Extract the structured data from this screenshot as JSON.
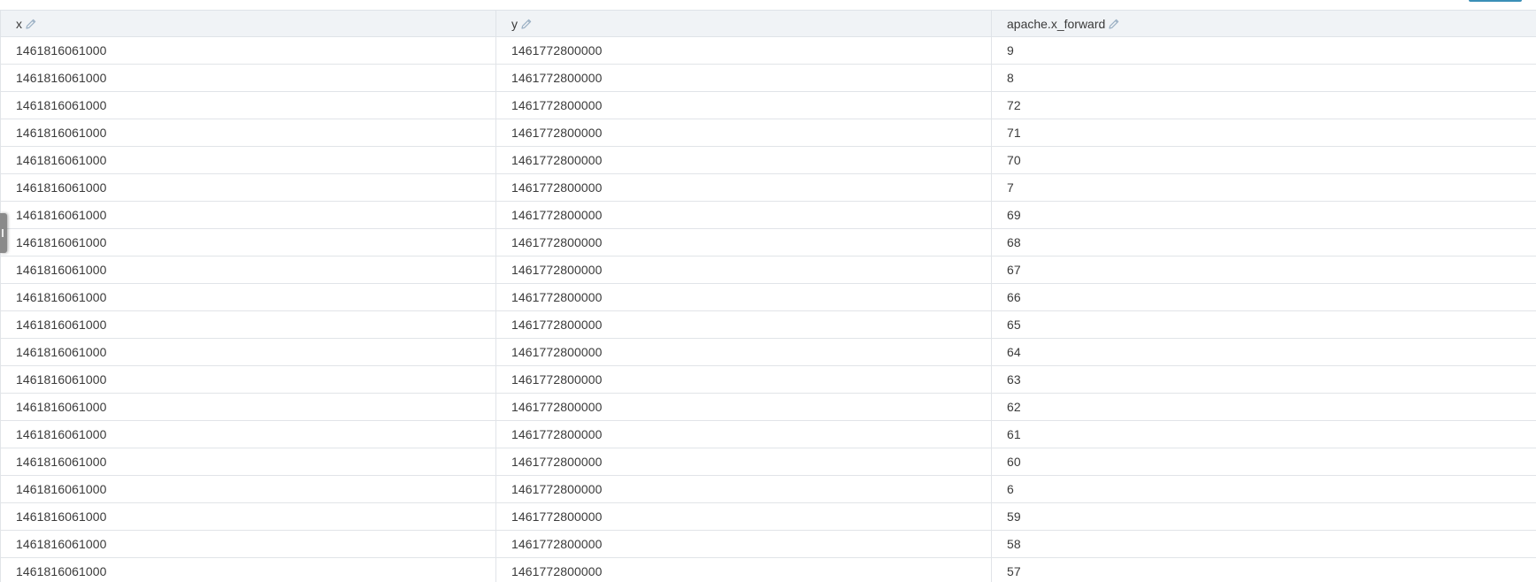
{
  "table": {
    "columns": [
      {
        "label": "x",
        "icon": "pencil-icon"
      },
      {
        "label": "y",
        "icon": "pencil-icon"
      },
      {
        "label": "apache.x_forward",
        "icon": "pencil-icon"
      }
    ],
    "rows": [
      [
        "1461816061000",
        "1461772800000",
        "9"
      ],
      [
        "1461816061000",
        "1461772800000",
        "8"
      ],
      [
        "1461816061000",
        "1461772800000",
        "72"
      ],
      [
        "1461816061000",
        "1461772800000",
        "71"
      ],
      [
        "1461816061000",
        "1461772800000",
        "70"
      ],
      [
        "1461816061000",
        "1461772800000",
        "7"
      ],
      [
        "1461816061000",
        "1461772800000",
        "69"
      ],
      [
        "1461816061000",
        "1461772800000",
        "68"
      ],
      [
        "1461816061000",
        "1461772800000",
        "67"
      ],
      [
        "1461816061000",
        "1461772800000",
        "66"
      ],
      [
        "1461816061000",
        "1461772800000",
        "65"
      ],
      [
        "1461816061000",
        "1461772800000",
        "64"
      ],
      [
        "1461816061000",
        "1461772800000",
        "63"
      ],
      [
        "1461816061000",
        "1461772800000",
        "62"
      ],
      [
        "1461816061000",
        "1461772800000",
        "61"
      ],
      [
        "1461816061000",
        "1461772800000",
        "60"
      ],
      [
        "1461816061000",
        "1461772800000",
        "6"
      ],
      [
        "1461816061000",
        "1461772800000",
        "59"
      ],
      [
        "1461816061000",
        "1461772800000",
        "58"
      ],
      [
        "1461816061000",
        "1461772800000",
        "57"
      ]
    ]
  },
  "colors": {
    "header_bg": "#f0f3f6",
    "border": "#e1e4e8",
    "text": "#3a3a3a",
    "icon": "#9bb0c4",
    "accent": "#3a8fb7"
  }
}
